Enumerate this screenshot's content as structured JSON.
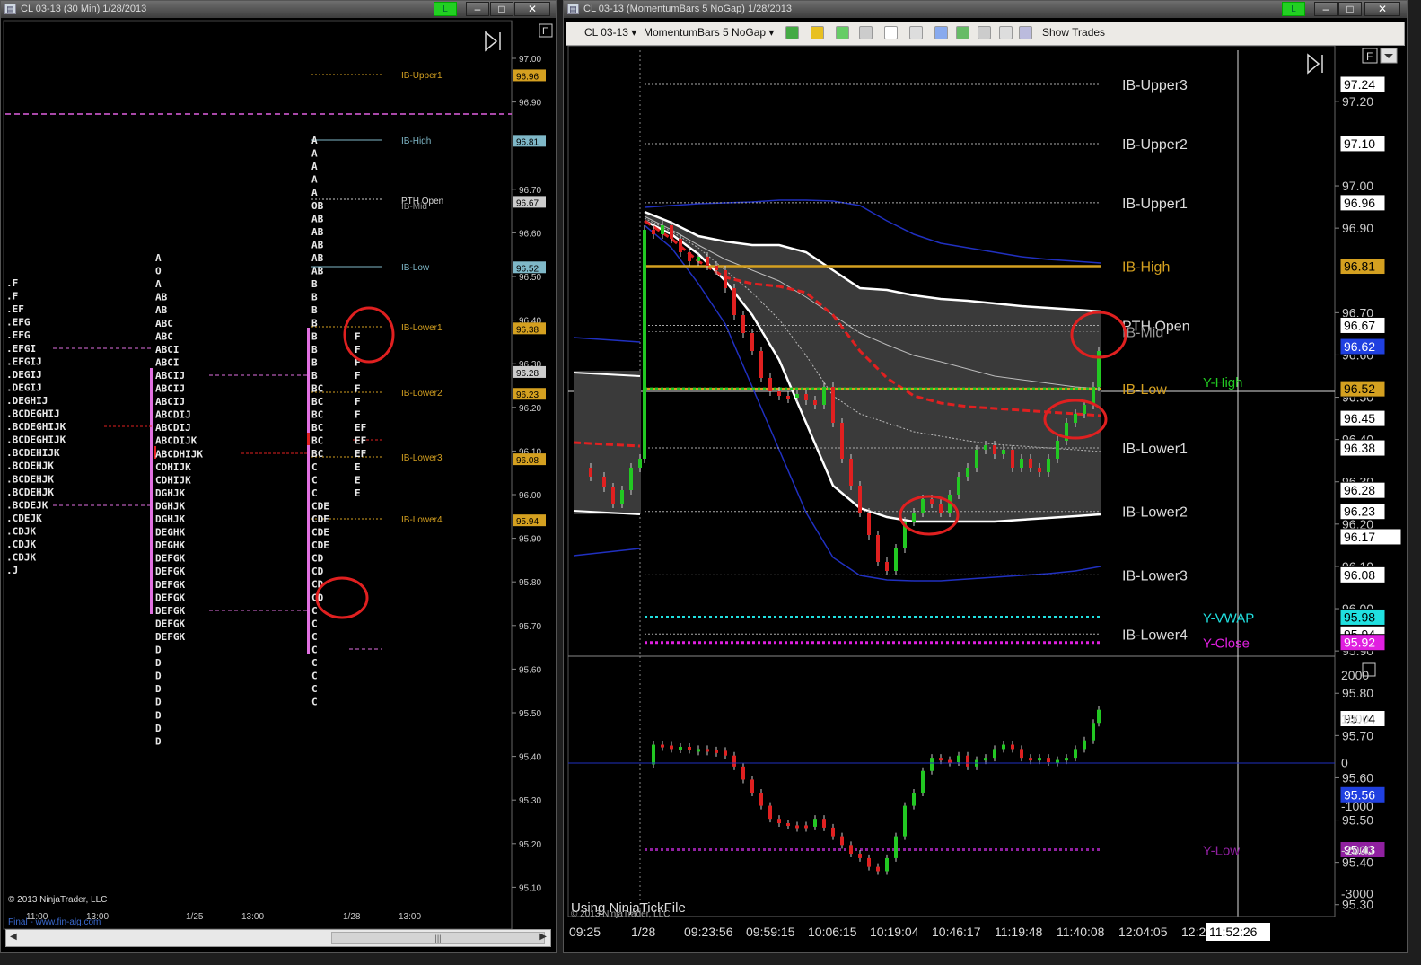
{
  "left_window": {
    "title": "CL 03-13 (30 Min)  1/28/2013",
    "live_badge": "L",
    "window_buttons": {
      "minimize": "–",
      "maximize": "□",
      "close": "✕"
    },
    "panel_flag": "F",
    "copyright": "© 2013 NinjaTrader, LLC",
    "watermark": "Final - www.fin-alg.com",
    "x_labels": [
      "11:00",
      "13:00",
      "1/25",
      "13:00",
      "1/28",
      "13:00"
    ],
    "price_ticks": [
      "97.00",
      "96.90",
      "96.70",
      "96.60",
      "96.50",
      "96.40",
      "96.30",
      "96.20",
      "96.10",
      "96.00",
      "95.90",
      "95.80",
      "95.70",
      "95.60",
      "95.50",
      "95.40",
      "95.30",
      "95.20",
      "95.10"
    ],
    "price_flags": [
      "96.96",
      "96.81",
      "96.67",
      "96.52",
      "96.38",
      "96.28",
      "96.23",
      "96.08",
      "95.94"
    ],
    "levels": [
      "IB-Upper1",
      "IB-High",
      "PTH Open",
      "IB-Mid",
      "IB-Low",
      "IB-Lower1",
      "IB-Lower2",
      "IB-Lower3",
      "IB-Lower4"
    ],
    "profile_col1": [
      ".F",
      ".F",
      ".EF",
      ".EFG",
      ".EFG",
      ".EFGI",
      ".EFGIJ",
      ".DEGIJ",
      ".DEGIJ",
      ".DEGHIJ",
      ".BCDEGHIJ",
      ".BCDEGHIJK",
      ".BCDEGHIJK",
      ".BCDEHIJK",
      ".BCDEHJK",
      ".BCDEHJK",
      ".BCDEHJK",
      ".BCDEJK",
      ".CDEJK",
      ".CDJK",
      ".CDJK",
      ".CDJK",
      ".J"
    ],
    "profile_col2": [
      "A",
      "O",
      "A",
      "AB",
      "AB",
      "ABC",
      "ABC",
      "ABCI",
      "ABCI",
      "ABCIJ",
      "ABCIJ",
      "ABCIJ",
      "ABCDIJ",
      "ABCDIJ",
      "ABCDIJK",
      "ABCDHIJK",
      "CDHIJK",
      "CDHIJK",
      "DGHJK",
      "DGHJK",
      "DGHJK",
      "DEGHK",
      "DEGHK",
      "DEFGK",
      "DEFGK",
      "DEFGK",
      "DEFGK",
      "DEFGK",
      "DEFGK",
      "DEFGK",
      "D",
      "D",
      "D",
      "D",
      "D",
      "D",
      "D",
      "D"
    ],
    "profile_col3": [
      "A",
      "A",
      "A",
      "A",
      "A",
      "OB",
      "AB",
      "AB",
      "AB",
      "AB",
      "AB",
      "B",
      "B",
      "B",
      "B",
      "B",
      "B",
      "B",
      "B",
      "BC",
      "BC",
      "BC",
      "BC",
      "BC",
      "BC",
      "C",
      "C",
      "C",
      "CDE",
      "CDE",
      "CDE",
      "CDE",
      "CD",
      "CD",
      "CD",
      "CD",
      "C",
      "C",
      "C",
      "C",
      "C",
      "C",
      "C",
      "C"
    ],
    "profile_col3b": [
      "",
      "",
      "",
      "",
      "",
      "",
      "",
      "",
      "",
      "",
      "",
      "",
      "",
      "",
      "",
      "F",
      "F",
      "F",
      "F",
      "F",
      "F",
      "F",
      "EF",
      "EF",
      "EF",
      "E",
      "E",
      "E"
    ],
    "scroll_grip": "|||"
  },
  "right_window": {
    "title": "CL 03-13 (MomentumBars 5 NoGap)  1/28/2013",
    "live_badge": "L",
    "window_buttons": {
      "minimize": "–",
      "maximize": "□",
      "close": "✕"
    },
    "toolbar": {
      "instrument": "CL 03-13",
      "bar_type": "MomentumBars 5 NoGap",
      "show_trades": "Show Trades"
    },
    "panel_flag": "F",
    "watermark_text": "Using NinjaTickFile",
    "copyright": "© 2013 NinjaTrader, LLC",
    "level_labels": [
      "IB-Upper3",
      "IB-Upper2",
      "IB-Upper1",
      "IB-High",
      "PTH Open",
      "IB-Mid",
      "IB-Low",
      "IB-Lower1",
      "IB-Lower2",
      "IB-Lower3",
      "IB-Lower4"
    ],
    "y_labels": [
      "Y-High",
      "Y-VWAP",
      "Y-Close",
      "Y-Low"
    ],
    "price_ticks": [
      "97.20",
      "97.00",
      "96.90",
      "96.70",
      "96.60",
      "96.50",
      "96.40",
      "96.30",
      "96.20",
      "96.10",
      "96.00",
      "95.90",
      "95.80",
      "95.70",
      "95.60",
      "95.50",
      "95.40",
      "95.30"
    ],
    "price_flags": [
      "97.24",
      "97.10",
      "96.96",
      "96.81",
      "96.67",
      "96.62",
      "96.52",
      "96.45",
      "96.38",
      "96.28",
      "96.23",
      "96.17",
      "96.08",
      "95.98",
      "95.94",
      "95.92",
      "95.74",
      "95.56",
      "95.43"
    ],
    "lower_ticks": [
      "2000",
      "1000",
      "0",
      "-1000",
      "-2000",
      "-3000"
    ],
    "time_labels": [
      "09:25",
      "1/28",
      "09:23:56",
      "09:59:15",
      "10:06:15",
      "10:19:04",
      "10:46:17",
      "11:19:48",
      "11:40:08",
      "12:04:05",
      "12:2"
    ],
    "cursor_time": "11:52:26",
    "colors": {
      "ib_high": "#d4a020",
      "y_high": "#22c822",
      "y_vwap": "#20e0e0",
      "y_close": "#e020e0",
      "y_low": "#9020a0",
      "vwap_line": "#e02020"
    }
  }
}
